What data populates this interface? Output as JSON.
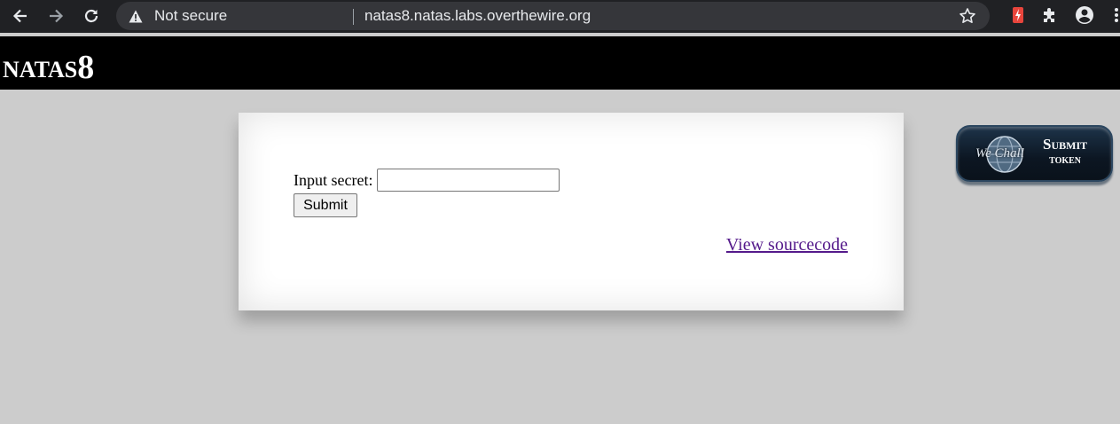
{
  "browser": {
    "security_status": "Not secure",
    "url": "natas8.natas.labs.overthewire.org",
    "icons": {
      "back": "back-arrow-icon",
      "forward": "forward-arrow-icon",
      "reload": "reload-icon",
      "warning": "warning-triangle-icon",
      "bookmark": "star-icon",
      "extension": "puzzle-icon",
      "profile": "account-icon",
      "menu": "kebab-menu-icon"
    }
  },
  "header": {
    "title_word": "natas",
    "title_number": "8"
  },
  "form": {
    "label": "Input secret:",
    "input_value": "",
    "submit_label": "Submit"
  },
  "link": {
    "view_source": "View sourcecode"
  },
  "badge": {
    "name": "We Chall",
    "submit": "Submit",
    "token": "token"
  },
  "colors": {
    "page_background": "#cccccc",
    "header_background": "#000000",
    "content_background": "#ffffff",
    "link": "#551a8b",
    "browser_toolbar": "#202124"
  }
}
